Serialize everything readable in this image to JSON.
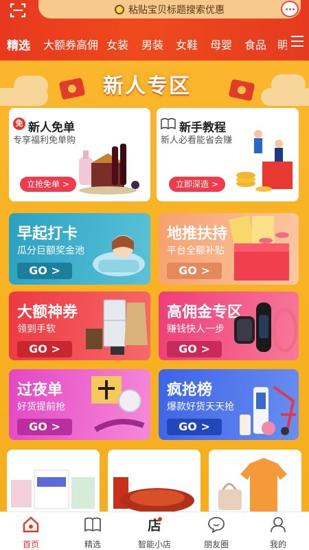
{
  "header": {
    "search_placeholder": "粘贴宝贝标题搜索优惠",
    "tabs": [
      {
        "label": "精选",
        "active": true
      },
      {
        "label": "大额券高佣"
      },
      {
        "label": "女装"
      },
      {
        "label": "男装"
      },
      {
        "label": "女鞋"
      },
      {
        "label": "母婴"
      },
      {
        "label": "食品"
      },
      {
        "label": "眀"
      }
    ]
  },
  "banner": {
    "title": "新人专区"
  },
  "newcomer_cards": [
    {
      "icon_text": "免",
      "title": "新人免单",
      "subtitle": "专享福利免单购",
      "button": "立抢免单 >"
    },
    {
      "title": "新手教程",
      "subtitle": "新人必看能省会赚",
      "button": "立即深造 >"
    }
  ],
  "promos": [
    {
      "title": "早起打卡",
      "subtitle": "瓜分巨额奖金池",
      "go": "GO >",
      "color": "#2ea0c0"
    },
    {
      "title": "地推扶持",
      "subtitle": "平台全额补贴",
      "go": "GO >",
      "color": "#f6a873"
    },
    {
      "title": "大额神券",
      "subtitle": "领到手软",
      "go": "GO >",
      "color": "#f0404b"
    },
    {
      "title": "高佣金专区",
      "subtitle": "赚钱快人一步",
      "go": "GO >",
      "color": "#f0407a"
    },
    {
      "title": "过夜单",
      "subtitle": "好货提前抢",
      "go": "GO >",
      "color": "#e449c6"
    },
    {
      "title": "疯抢榜",
      "subtitle": "爆款好货天天抢",
      "go": "GO >",
      "color": "#3a62e8"
    }
  ],
  "nav": [
    {
      "label": "首页",
      "active": true,
      "icon": "home-icon"
    },
    {
      "label": "精选",
      "icon": "book-icon"
    },
    {
      "label": "智能小店",
      "icon": "store-icon"
    },
    {
      "label": "朋友圈",
      "icon": "chat-icon"
    },
    {
      "label": "我的",
      "icon": "user-icon"
    }
  ],
  "colors": {
    "header_red": "#e8381f",
    "page_orange": "#f7b120",
    "accent_red": "#e8332a"
  }
}
